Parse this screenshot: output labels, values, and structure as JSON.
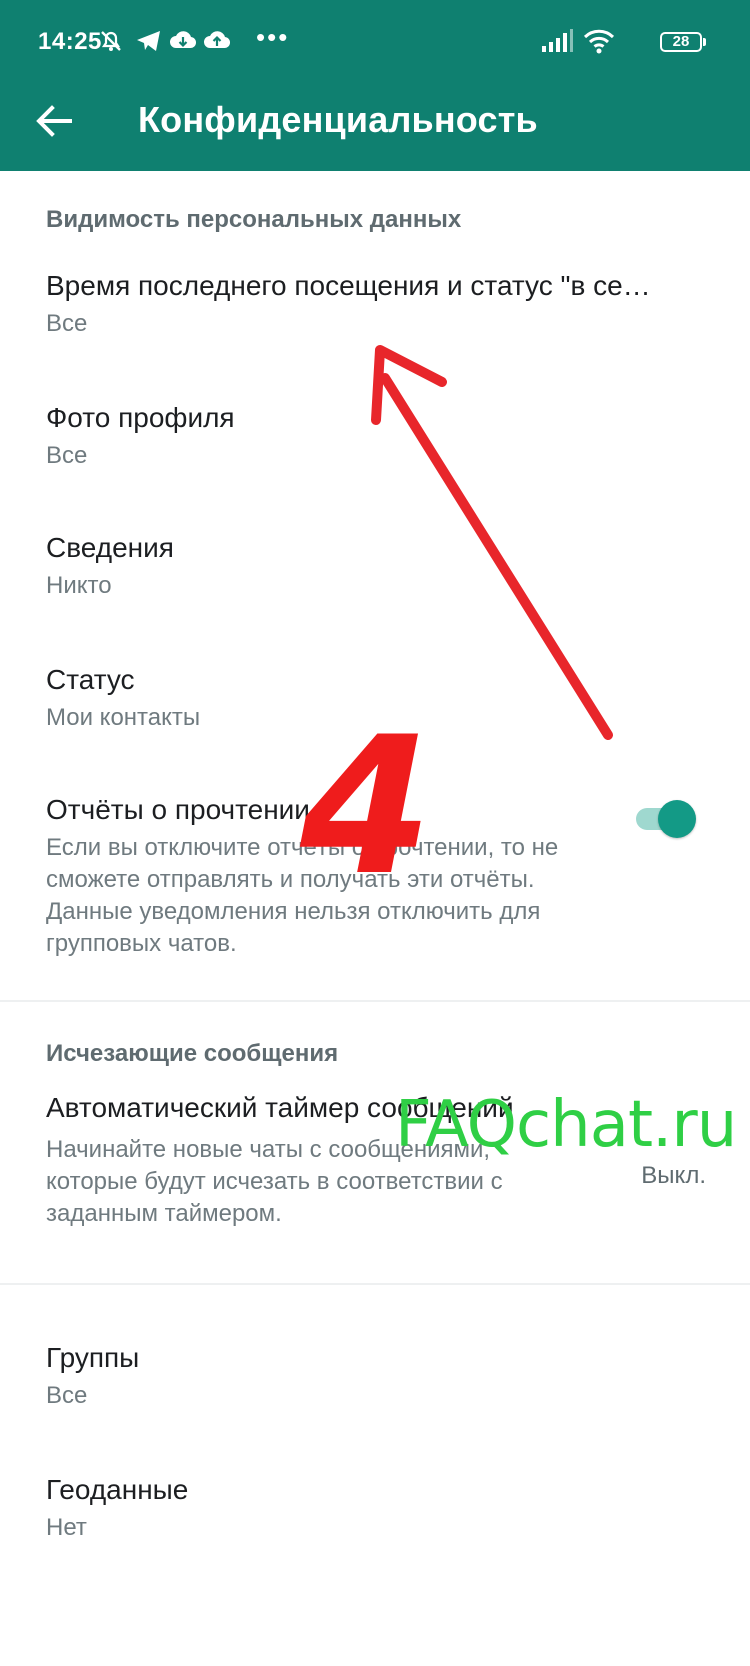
{
  "status_bar": {
    "time": "14:25",
    "dots": "•••",
    "battery": "28"
  },
  "app_bar": {
    "title": "Конфиденциальность"
  },
  "sections": {
    "personal": {
      "header": "Видимость персональных данных",
      "items": [
        {
          "title": "Время последнего посещения и статус \"в се…",
          "value": "Все"
        },
        {
          "title": "Фото профиля",
          "value": "Все"
        },
        {
          "title": "Сведения",
          "value": "Никто"
        },
        {
          "title": "Статус",
          "value": "Мои контакты"
        }
      ],
      "read_receipts": {
        "title": "Отчёты о прочтении",
        "description": "Если вы отключите отчёты о прочтении, то не сможете отправлять и получать эти отчёты. Данные уведомления нельзя отключить для групповых чатов.",
        "enabled": true
      }
    },
    "disappearing": {
      "header": "Исчезающие сообщения",
      "timer": {
        "title": "Автоматический таймер сообщений",
        "description": "Начинайте новые чаты с сообщениями, которые будут исчезать в соответствии с заданным таймером.",
        "value": "Выкл."
      }
    },
    "other": {
      "items": [
        {
          "title": "Группы",
          "value": "Все"
        },
        {
          "title": "Геоданные",
          "value": "Нет"
        }
      ]
    }
  },
  "overlays": {
    "step_number": "4",
    "watermark": "FAQchat.ru",
    "arrow_color": "#e8262b"
  },
  "colors": {
    "app_bar": "#0f8070",
    "toggle_on": "#139a86",
    "watermark": "#2fcf45",
    "step_number": "#ef1c1c"
  }
}
